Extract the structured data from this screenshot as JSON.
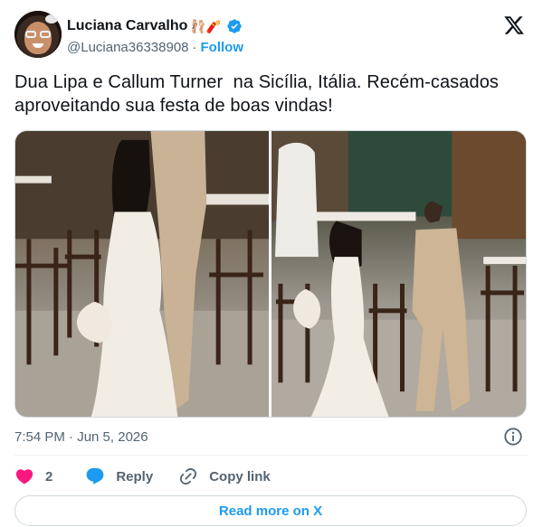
{
  "author": {
    "name": "Luciana Carvalho",
    "name_emojis": "🩰🧨",
    "handle": "@Luciana36338908",
    "follow_label": "Follow",
    "separator": "·"
  },
  "tweet": {
    "text": "Dua Lipa e Callum Turner  na Sicília, Itália. Recém-casados aproveitando sua festa de boas vindas!",
    "timestamp": "7:54 PM · Jun 5, 2026"
  },
  "media": {
    "count": 2
  },
  "actions": {
    "like_count": "2",
    "reply_label": "Reply",
    "copy_label": "Copy link"
  },
  "read_more_label": "Read more on X",
  "colors": {
    "accent": "#1d9bf0",
    "like": "#f91880",
    "text": "#0f1419",
    "secondary": "#536471",
    "border": "#cfd9de"
  },
  "icons": [
    "verified-badge-icon",
    "x-logo-icon",
    "info-icon",
    "heart-icon",
    "reply-bubble-icon",
    "link-icon"
  ]
}
